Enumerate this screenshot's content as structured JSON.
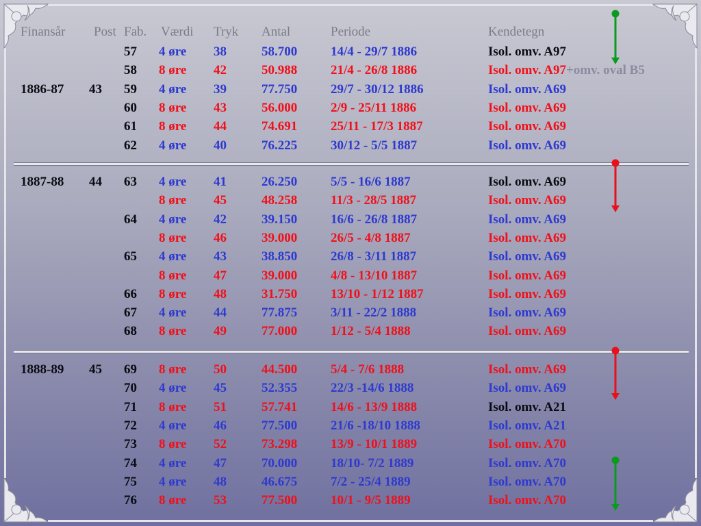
{
  "headers": {
    "finansaar": "Finansår",
    "post": "Post",
    "fab": "Fab.",
    "vaerdi": "Værdi",
    "tryk": "Tryk",
    "antal": "Antal",
    "periode": "Periode",
    "kendetegn": "Kendetegn"
  },
  "colors": {
    "black": "#0b0b12",
    "red": "#f0101a",
    "blue": "#2e39cf",
    "green": "#0a9b1e",
    "header": "#7c7c88"
  },
  "rows": [
    {
      "fin": "",
      "post": "",
      "fab": "57",
      "vaerdi": "4 øre",
      "tryk": "38",
      "antal": "58.700",
      "periode": "14/4 - 29/7 1886",
      "kende": "Isol. omv. A97",
      "extra": "",
      "color": "blue",
      "kende_color": "black"
    },
    {
      "fin": "",
      "post": "",
      "fab": "58",
      "vaerdi": "8 øre",
      "tryk": "42",
      "antal": "50.988",
      "periode": "21/4 - 26/8 1886",
      "kende": "Isol. omv. A97",
      "extra": "+omv. oval B5",
      "color": "red",
      "kende_color": "red"
    },
    {
      "fin": "1886-87",
      "post": "43",
      "fab": "59",
      "vaerdi": "4 øre",
      "tryk": "39",
      "antal": "77.750",
      "periode": "29/7 - 30/12 1886",
      "kende": "Isol. omv. A69",
      "extra": "",
      "color": "blue",
      "kende_color": "blue"
    },
    {
      "fin": "",
      "post": "",
      "fab": "60",
      "vaerdi": "8 øre",
      "tryk": "43",
      "antal": "56.000",
      "periode": "2/9 - 25/11 1886",
      "kende": "Isol. omv. A69",
      "extra": "",
      "color": "red",
      "kende_color": "red"
    },
    {
      "fin": "",
      "post": "",
      "fab": "61",
      "vaerdi": "8 øre",
      "tryk": "44",
      "antal": "74.691",
      "periode": "25/11 - 17/3 1887",
      "kende": "Isol. omv. A69",
      "extra": "",
      "color": "red",
      "kende_color": "red"
    },
    {
      "fin": "",
      "post": "",
      "fab": "62",
      "vaerdi": "4 øre",
      "tryk": "40",
      "antal": "76.225",
      "periode": "30/12 - 5/5 1887",
      "kende": "Isol. omv. A69",
      "extra": "",
      "color": "blue",
      "kende_color": "blue"
    },
    {
      "fin": "1887-88",
      "post": "44",
      "fab": "63",
      "vaerdi": "4 øre",
      "tryk": "41",
      "antal": "26.250",
      "periode": "5/5 - 16/6 1887",
      "kende": "Isol. omv. A69",
      "extra": "",
      "color": "blue",
      "kende_color": "black"
    },
    {
      "fin": "",
      "post": "",
      "fab": "",
      "vaerdi": "8 øre",
      "tryk": "45",
      "antal": "48.258",
      "periode": "11/3 - 28/5 1887",
      "kende": "Isol. omv. A69",
      "extra": "",
      "color": "red",
      "kende_color": "red"
    },
    {
      "fin": "",
      "post": "",
      "fab": "64",
      "vaerdi": "4 øre",
      "tryk": "42",
      "antal": "39.150",
      "periode": "16/6 - 26/8 1887",
      "kende": "Isol. omv. A69",
      "extra": "",
      "color": "blue",
      "kende_color": "blue"
    },
    {
      "fin": "",
      "post": "",
      "fab": "",
      "vaerdi": "8 øre",
      "tryk": "46",
      "antal": "39.000",
      "periode": "26/5 - 4/8 1887",
      "kende": "Isol. omv. A69",
      "extra": "",
      "color": "red",
      "kende_color": "red"
    },
    {
      "fin": "",
      "post": "",
      "fab": "65",
      "vaerdi": "4 øre",
      "tryk": "43",
      "antal": "38.850",
      "periode": "26/8 - 3/11 1887",
      "kende": "Isol. omv. A69",
      "extra": "",
      "color": "blue",
      "kende_color": "blue"
    },
    {
      "fin": "",
      "post": "",
      "fab": "",
      "vaerdi": "8 øre",
      "tryk": "47",
      "antal": "39.000",
      "periode": "4/8 - 13/10 1887",
      "kende": "Isol. omv. A69",
      "extra": "",
      "color": "red",
      "kende_color": "red"
    },
    {
      "fin": "",
      "post": "",
      "fab": "66",
      "vaerdi": "8 øre",
      "tryk": "48",
      "antal": "31.750",
      "periode": "13/10 - 1/12 1887",
      "kende": "Isol. omv. A69",
      "extra": "",
      "color": "red",
      "kende_color": "red"
    },
    {
      "fin": "",
      "post": "",
      "fab": "67",
      "vaerdi": "4 øre",
      "tryk": "44",
      "antal": "77.875",
      "periode": "3/11 - 22/2 1888",
      "kende": "Isol. omv. A69",
      "extra": "",
      "color": "blue",
      "kende_color": "blue"
    },
    {
      "fin": "",
      "post": "",
      "fab": "68",
      "vaerdi": "8 øre",
      "tryk": "49",
      "antal": "77.000",
      "periode": "1/12 - 5/4 1888",
      "kende": "Isol. omv. A69",
      "extra": "",
      "color": "red",
      "kende_color": "red"
    },
    {
      "fin": "1888-89",
      "post": "45",
      "fab": "69",
      "vaerdi": "8 øre",
      "tryk": "50",
      "antal": "44.500",
      "periode": "5/4 - 7/6 1888",
      "kende": "Isol. omv. A69",
      "extra": "",
      "color": "red",
      "kende_color": "red"
    },
    {
      "fin": "",
      "post": "",
      "fab": "70",
      "vaerdi": "4 øre",
      "tryk": "45",
      "antal": "52.355",
      "periode": "22/3 -14/6 1888",
      "kende": "Isol. omv. A69",
      "extra": "",
      "color": "blue",
      "kende_color": "blue"
    },
    {
      "fin": "",
      "post": "",
      "fab": "71",
      "vaerdi": "8 øre",
      "tryk": "51",
      "antal": "57.741",
      "periode": "14/6 - 13/9 1888",
      "kende": "Isol. omv. A21",
      "extra": "",
      "color": "red",
      "kende_color": "black"
    },
    {
      "fin": "",
      "post": "",
      "fab": "72",
      "vaerdi": "4 øre",
      "tryk": "46",
      "antal": "77.500",
      "periode": "21/6 -18/10 1888",
      "kende": "Isol. omv. A21",
      "extra": "",
      "color": "blue",
      "kende_color": "blue"
    },
    {
      "fin": "",
      "post": "",
      "fab": "73",
      "vaerdi": "8 øre",
      "tryk": "52",
      "antal": "73.298",
      "periode": "13/9 - 10/1 1889",
      "kende": "Isol. omv. A70",
      "extra": "",
      "color": "red",
      "kende_color": "red"
    },
    {
      "fin": "",
      "post": "",
      "fab": "74",
      "vaerdi": "4 øre",
      "tryk": "47",
      "antal": "70.000",
      "periode": "18/10- 7/2 1889",
      "kende": "Isol. omv. A70",
      "extra": "",
      "color": "blue",
      "kende_color": "blue"
    },
    {
      "fin": "",
      "post": "",
      "fab": "75",
      "vaerdi": "4 øre",
      "tryk": "48",
      "antal": "46.675",
      "periode": "7/2 - 25/4 1889",
      "kende": "Isol. omv. A70",
      "extra": "",
      "color": "blue",
      "kende_color": "blue"
    },
    {
      "fin": "",
      "post": "",
      "fab": "76",
      "vaerdi": "8 øre",
      "tryk": "53",
      "antal": "77.500",
      "periode": "10/1 - 9/5 1889",
      "kende": "Isol. omv. A70",
      "extra": "",
      "color": "red",
      "kende_color": "red"
    }
  ],
  "markers": [
    {
      "name": "green-arrow-top",
      "color": "green",
      "icon": "dot-arrow-down"
    },
    {
      "name": "red-arrow-1887",
      "color": "red",
      "icon": "dot-arrow-down"
    },
    {
      "name": "red-arrow-1888",
      "color": "red",
      "icon": "dot-arrow-down"
    },
    {
      "name": "green-arrow-bottom",
      "color": "green",
      "icon": "dot-arrow-down"
    }
  ]
}
